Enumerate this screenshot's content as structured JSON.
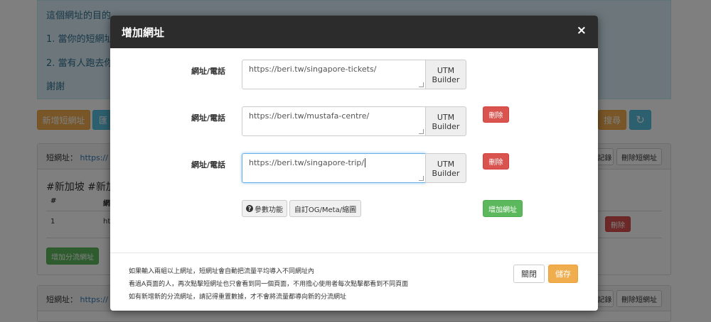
{
  "background": {
    "info_lines": [
      "這個網址的目的",
      "1. 當你的短網址",
      "2. 當有人跑去你",
      "謝謝"
    ],
    "buttons": {
      "new_short_url": "新增短網址",
      "import": "匯",
      "search": "搜尋",
      "refresh_icon": "↻"
    },
    "panel1": {
      "label": "短網址：",
      "link": "https://",
      "record_btn": "記錄",
      "delete_short_btn": "刪除短網址",
      "hashtags": "#新加坡 #新加",
      "table_header_num": "#",
      "table_header_col": "網",
      "row_num": "1",
      "row_url": "ht",
      "row_delete": "刪除",
      "add_split_btn": "增加分流網址"
    },
    "panel2": {
      "label": "短網址：",
      "link": "https://",
      "record_btn": "記錄",
      "delete_short_btn": "刪除短網址"
    }
  },
  "modal": {
    "title": "增加網址",
    "close_icon": "×",
    "rows": [
      {
        "label": "網址/電話",
        "value": "https://beri.tw/singapore-tickets/",
        "utm_line1": "UTM",
        "utm_line2": "Builder"
      },
      {
        "label": "網址/電話",
        "value": "https://beri.tw/mustafa-centre/",
        "utm_line1": "UTM",
        "utm_line2": "Builder",
        "delete": "刪除"
      },
      {
        "label": "網址/電話",
        "value": "https://beri.tw/singapore-trip/",
        "utm_line1": "UTM",
        "utm_line2": "Builder",
        "delete": "刪除"
      }
    ],
    "params_btn": "參數功能",
    "og_btn": "自訂OG/Meta/縮圖",
    "add_url_btn": "增加網址",
    "notes": [
      "如果輸入兩組以上網址，短網址會自動把流量平均導入不同網址內",
      "看過A頁面的人，再次點擊短網址也只會看到同一個頁面，不用擔心使用者每次點擊都看到不同頁面",
      "如有新增新的分流網址，請記得重置數據，才不會將流量都導向新的分流網址"
    ],
    "close_btn": "關閉",
    "save_btn": "儲存"
  }
}
